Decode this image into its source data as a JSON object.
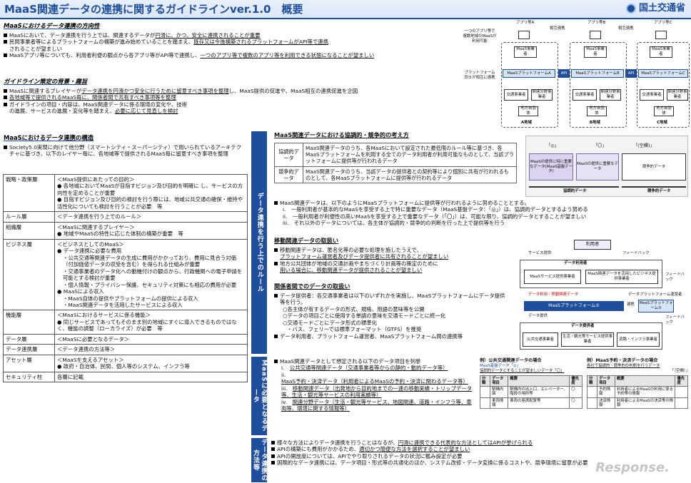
{
  "header": {
    "title": "MaaS関連データの連携に関するガイドラインver.1.0　概要",
    "logo_text": "国土交通省"
  },
  "s1": {
    "heading": "MaaSにおけるデータ連携の方向性",
    "b1a": "MaaSにおいて、データ連携を行う上では、関連するデータが",
    "b1b": "円滑に、かつ、安全に連携されることが重要",
    "b2a": "民間事業者等によるプラットフォームの構築が進み始めていることを踏まえ、",
    "b2b": "既存又は今後構築されるプラットフォームがAPI等で連携",
    "b2c": "されることが望ましい",
    "b3a": "MaaSアプリ等についても、利用者利便の観点から各アプリ等がAPI等で連携し、",
    "b3b": "一つのアプリ等で複数のアプリ等を利用できる状態になることが望ましい"
  },
  "s2": {
    "heading": "ガイドライン策定の背景・趣旨",
    "b1a": "MaaSに関連するプレイヤーが",
    "b1b": "データ連携を円滑かつ安全に行うために留意すべき事項を整理",
    "b1c": "し、MaaS提供の促進や、MaaS相互の連携促進を企図",
    "b2": "各地域等で提供されるMaaS毎に、関係者間で共有すべき事項等を整理",
    "b3a": "ガイドラインの項目・内容は、MaaS関連データに係る環境の変化や、技術",
    "b3b": "の進展、サービスの進展・変化等を踏まえ、",
    "b3c": "必要に応じて見直しを検討"
  },
  "s3": {
    "heading": "MaaSにおけるデータ連携の構造",
    "b1": "Society5.0実現に向けて他分野（スマートシティ・スーパーシティ）で用いられているアーキテクチャに基づき、以下のレイヤー毎に、各地域等で提供されるMaaS毎に留意すべき事項を整理"
  },
  "layers": [
    {
      "name": "戦略・政策層",
      "lines": [
        "＜MaaS提供にあたっての目的＞",
        "● 各地域においてMaaSが目指すビジョン及び目的を明確に し、サービスの方向性を定めることが重要",
        "● 目指すビジョン及び目的の検討を行う際には、地域公共交通の確保・維持や活性化についても検討を行うことが必要　等"
      ]
    },
    {
      "name": "ルール層",
      "lines": [
        "＜データ連携を行う上でのルール＞"
      ]
    },
    {
      "name": "組織層",
      "lines": [
        "＜MaaSに関連するプレイヤー＞",
        "● 地域やMaaSの特性に応じた体制の構築が重要　等"
      ]
    },
    {
      "name": "ビジネス層",
      "lines": [
        "＜ビジネスとしてのMaaS＞",
        "● データ連携に必要な費用",
        "・公共交通等関連データの生成に費用がかかっており、費用に見合う対価（付加価値データの収受を含む）を得られる仕組みが重要",
        "・交通事業者のデータ化への動機付けの観点から、行政機関への電子申請を可能とする検討が重要",
        "・個人情報・プライバシー保護、セキュリティ対策にも相応の費用が必要",
        "● MaaSによる収入",
        "・MaaS自体の提供やプラットフォームの提供による収入",
        "・MaaS関連データを活用したサービスによる収入"
      ]
    },
    {
      "name": "機能層",
      "lines": [
        "＜MaaSにおけるサービスに係る機能＞",
        "● 同じサービスであってもそのまま別の地域にすぐに導入できるものではなく、機能の調整（ローカライズ）が必要　等"
      ]
    },
    {
      "name": "データ層",
      "lines": [
        "＜MaaSに必要となるデータ＞"
      ]
    },
    {
      "name": "データ連携層",
      "lines": [
        "＜データ連携の方法等＞"
      ]
    },
    {
      "name": "アセット層",
      "lines": [
        "＜MaaSを支えるアセット＞",
        "● 政府・自治体、民間、個人等のシステム、インフラ等"
      ]
    },
    {
      "name": "セキュリティ柱",
      "lines": [
        "各層に記載"
      ]
    }
  ],
  "bands": {
    "rules": "データ連携を行う上でのルール",
    "data": "MaaSに必要となるデータ",
    "method": "データ連携の方法等"
  },
  "coop": {
    "heading": "MaaS関連データにおける協調的・競争的の考え方",
    "row1_label": "協調的データ",
    "row1_text": "MaaS関連データのうち、各MaaSにおいて設定された最低限のルール等に基づき、各MaaSプラットフォームを利用する全てのデータ利用者が利用可能なものとして、当該プラットフォームに提供等が行われるデータ",
    "row2_label": "競争的データ",
    "row2_text": "MaaS関連データのうち、当該データの提供者との契約等により個別に共有が行われるものとして、各MaaSプラットフォームに提供等が行われるデータ",
    "chart_col1": "「◎」",
    "chart_col2": "「〇」",
    "chart_col3": "「(空欄)」",
    "chart_box1": "MaaSの提供に特に重要なデータ(MaaS基盤データ)",
    "chart_box2": "MaaSの提供に重要なデータ",
    "chart_box3": "競争的データ",
    "chart_axis1": "協調的データ",
    "chart_axis2": "競争的データ",
    "intro": "MaaS関連データは、以下のようにMaaSプラットフォームに提供等が行われるように努めることとする。",
    "i": "一般利用者が基本的なMaaSを享受する上で特に重要なデータ（MaaS基盤データ：「◎」）は、協調的データとするよう努める",
    "ii": "一般利用者が利便性の高いMaaSを享受する上で重要なデータ（「〇」）は、可能な限り、協調的データとすることが望ましい",
    "iii": "それ以外のデータについては、各主体が協調的・競争的の判断を行った上で提供等を行う"
  },
  "mobility": {
    "heading": "移動関連データの取扱い",
    "b1a": "移動関連データは、匿名化等の必要な処理を施したうえで、",
    "b1b": "プラットフォーム運営者及びデータ提供者に共有されることが望ましい",
    "b2a": "地方公共団体が地域の交通計画やまちづくり計画等の策定のために",
    "b2b": "用いる場合に、移動関連データが提供されることが望ましい"
  },
  "between": {
    "heading": "関係者間でのデータの取扱い",
    "b1": "データ提供者：各交通事業者は以下のいずれかを実施し、MaaSプラットフォームにデータ提供等を行う。",
    "o1": "○各主体が有するデータの形式、規格、用語の意味等を公開",
    "o2": "○データの項目ごとに使用する単語の意味を交通モードごとに統一化",
    "o3": "○交通モードごとにデータ形式の標準化",
    "o3b": "・バス、フェリーでは標準フォーマット（GTFS）を推奨",
    "b2": "データ利用者、プラットフォーム運営者、MaaSプラットフォーム間の連携等"
  },
  "required": {
    "intro": "MaaS関連データとして想定される以下のデータ項目を列挙",
    "i": "公共交通等関連データ（交通事業者等からの静的・動的データ等）",
    "ii": "MaaS予約・決済データ（利用者によるMaaSの予約・決済に関わるデータ等）",
    "iii": "移動関連データ（出発地から目的地までの一連の移動実績・トリップデータ等、生活・観光等サービスの利用実績等）",
    "iv": "関連分野データ（生活・観光等サービス、地図関連、道路・インフラ等、車両等、環境に関する情報等）",
    "ex1_title": "例）公共交通関連データの場合",
    "ex1_sub": "MaaS基盤データ「◎」",
    "ex1_sub2": "協調的データとすることが望ましいデータ「〇」",
    "ex2_title": "例）MaaS予約・決済データの場合",
    "ex2_sub": "各社で協調的・競争的の判断を行うデータ",
    "ex2_sub2": "「（空欄）」",
    "t_headers": [
      "分類",
      "データ項目",
      "概要",
      "優先度"
    ],
    "t1_rows": [
      [
        "駅構内図",
        "駅構内の出入口、エレベーター、階段の場所等",
        "〇"
      ],
      [
        "車両情報",
        "車両の座席配置等",
        "〇"
      ]
    ],
    "t2_rows": [
      [
        "予約情報",
        "利用者によるMaaSの利用に係る予約等の情報",
        ""
      ],
      [
        "決済情報",
        "利用者によるMaaSの決済等の情報",
        ""
      ]
    ]
  },
  "method": {
    "b1a": "様々な方法によりデータ連携を行うことはなるが、",
    "b1b": "円滑に連携できる代表的な方法としてはAPIが挙げられる",
    "b2a": "APIの構築にも費用がかかるため、",
    "b2b": "適切かつ簡便な方法を選択することが望ましい",
    "b3": "APIの開放度については、APIでやり取りされるデータの状況に鑑み設定が必要",
    "b4": "国際的なデータ連携には、データ項目・形式等の共通化のほか、システム改修・データ変換に係るコストや、競争環境に留意が必要"
  },
  "diagram1": {
    "app_a": "アプリ等A",
    "app_b": "アプリ等B",
    "app_c": "アプリ等C",
    "note_left": "一つのアプリ等で複数地域のMaaSが利用可能",
    "mutual": "相互連携",
    "maas_op": "MaaS事業者",
    "pf_a": "MaaSプラットフォームA",
    "pf_b": "MaaSプラットフォームB",
    "pf_c": "MaaSプラットフォームC",
    "api": "API",
    "pf_note": "プラットフォーム同士が相互に連携",
    "transit": "交通事業者",
    "related": "関連分野事業者",
    "local_gov": "地方自治体",
    "region_a": "A地域",
    "region_b": "B地域",
    "region_c": "C地域"
  },
  "diagram2": {
    "user": "利用者",
    "service": "サービス提供",
    "feedback": "フィードバック",
    "data_user": "データ利用者",
    "svc_provider": "MaaSサービス提供事業者",
    "svc_related": "MaaS関連データを活用したビジネス提供事業者",
    "pf1": "MaaSプラットフォーム①",
    "pf2": "MaaSプラットフォーム②",
    "link": "連携",
    "data_pf_op": "データプラットフォーム運営者",
    "data_provider": "データ提供者",
    "prov1": "公共交通事業者",
    "prov2": "生活・観光等サービス提供事業者",
    "prov3": "道路・インフラ事業者",
    "data_supply": "データ提供",
    "data_use": "データ利用",
    "mobility_use": "データ利用・移動関連データ"
  },
  "watermark": "Response."
}
